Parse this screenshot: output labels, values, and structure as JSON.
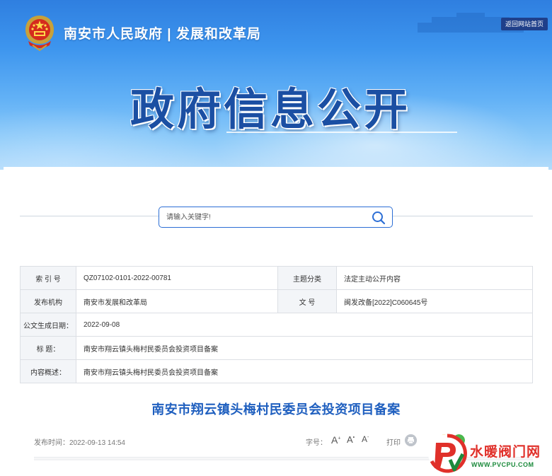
{
  "header": {
    "site_title": "南安市人民政府 | 发展和改革局",
    "back_button": "返回网站首页",
    "banner_title": "政府信息公开"
  },
  "search": {
    "placeholder": "请输入关键字!"
  },
  "info": {
    "index_label": "索 引 号",
    "index_value": "QZ07102-0101-2022-00781",
    "category_label": "主题分类",
    "category_value": "法定主动公开内容",
    "publisher_label": "发布机构",
    "publisher_value": "南安市发展和改革局",
    "docno_label": "文 号",
    "docno_value": "闽发改备[2022]C060645号",
    "date_label": "公文生成日期：",
    "date_value": "2022-09-08",
    "title_label": "标 题：",
    "title_value": "南安市翔云镇头梅村民委员会投资项目备案",
    "summary_label": "内容概述：",
    "summary_value": "南安市翔云镇头梅村民委员会投资项目备案"
  },
  "article": {
    "title": "南安市翔云镇头梅村民委员会投资项目备案",
    "publish_time": "发布时间：2022-09-13 14:54",
    "font_size_label": "字号：",
    "font_sizes": [
      "A",
      "A",
      "A"
    ],
    "print_label": "打印"
  },
  "watermark": {
    "name": "水暖阀门网",
    "url": "WWW.PVCPU.COM"
  },
  "colors": {
    "accent": "#1f5fbf",
    "search_border": "#2c6ed5",
    "watermark_red": "#e0302a",
    "watermark_green": "#1c8a3c"
  }
}
